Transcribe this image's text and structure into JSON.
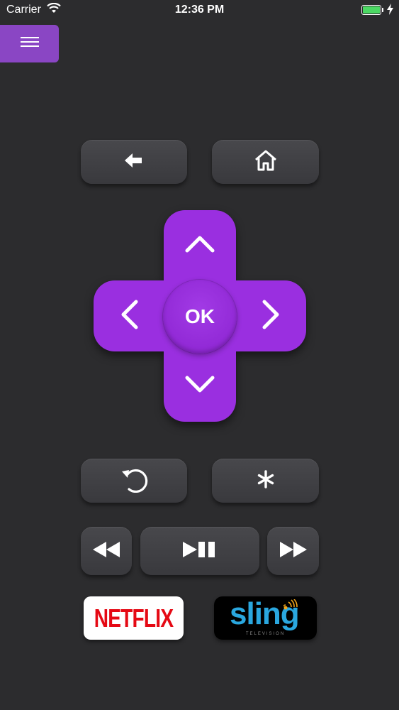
{
  "status_bar": {
    "carrier": "Carrier",
    "time": "12:36 PM",
    "battery_color": "#4cd964"
  },
  "menu": {
    "icon": "hamburger-menu-icon",
    "color": "#8a46c4"
  },
  "top_keys": [
    {
      "name": "back",
      "icon": "back-arrow-icon"
    },
    {
      "name": "home",
      "icon": "home-icon"
    }
  ],
  "dpad": {
    "color": "#9a2fe0",
    "ok_label": "OK",
    "icons": [
      "chevron-up-icon",
      "chevron-left-icon",
      "chevron-right-icon",
      "chevron-down-icon"
    ]
  },
  "mid_keys": [
    {
      "name": "instant-replay",
      "icon": "replay-icon"
    },
    {
      "name": "options",
      "icon": "asterisk-icon"
    }
  ],
  "playback_keys": [
    {
      "name": "rewind",
      "icon": "rewind-icon"
    },
    {
      "name": "play-pause",
      "icon": "play-pause-icon"
    },
    {
      "name": "fast-forward",
      "icon": "fast-forward-icon"
    }
  ],
  "channels": {
    "netflix_label": "NETFLIX",
    "netflix_color": "#e50914",
    "sling_label": "sling",
    "sling_sub": "TELEVISION",
    "sling_color": "#2aa7df"
  }
}
